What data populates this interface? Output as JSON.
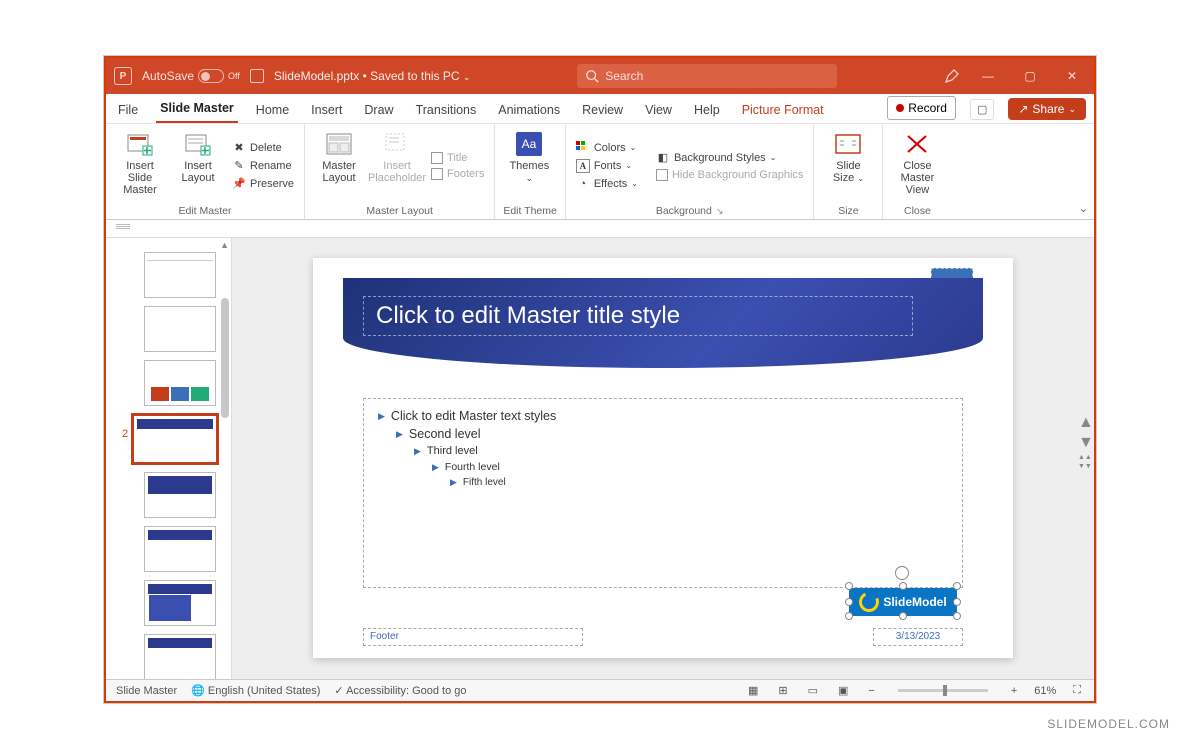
{
  "titlebar": {
    "autosave_label": "AutoSave",
    "autosave_state": "Off",
    "filename": "SlideModel.pptx",
    "saved_state": "Saved to this PC",
    "search_placeholder": "Search"
  },
  "tabs": {
    "file": "File",
    "slide_master": "Slide Master",
    "home": "Home",
    "insert": "Insert",
    "draw": "Draw",
    "transitions": "Transitions",
    "animations": "Animations",
    "review": "Review",
    "view": "View",
    "help": "Help",
    "picture_format": "Picture Format",
    "record": "Record",
    "share": "Share"
  },
  "ribbon": {
    "edit_master": {
      "label": "Edit Master",
      "insert_slide_master": "Insert Slide\nMaster",
      "insert_layout": "Insert\nLayout",
      "delete": "Delete",
      "rename": "Rename",
      "preserve": "Preserve"
    },
    "master_layout": {
      "label": "Master Layout",
      "master_layout_btn": "Master\nLayout",
      "insert_placeholder": "Insert\nPlaceholder",
      "title": "Title",
      "footers": "Footers"
    },
    "edit_theme": {
      "label": "Edit Theme",
      "themes": "Themes"
    },
    "background": {
      "label": "Background",
      "colors": "Colors",
      "fonts": "Fonts",
      "effects": "Effects",
      "bg_styles": "Background Styles",
      "hide_bg": "Hide Background Graphics"
    },
    "size": {
      "label": "Size",
      "slide_size": "Slide\nSize"
    },
    "close": {
      "label": "Close",
      "close_master": "Close\nMaster View"
    }
  },
  "thumbs": {
    "selected_index": "2"
  },
  "slide": {
    "title_placeholder": "Click to edit Master title style",
    "pagenum_symbol": "‹#›",
    "body_levels": [
      "Click to edit Master text styles",
      "Second level",
      "Third level",
      "Fourth level",
      "Fifth level"
    ],
    "footer_placeholder": "Footer",
    "date_placeholder": "3/13/2023",
    "logo_text": "SlideModel"
  },
  "status": {
    "mode": "Slide Master",
    "language": "English (United States)",
    "accessibility": "Accessibility: Good to go",
    "zoom": "61%"
  },
  "watermark": "SLIDEMODEL.COM"
}
